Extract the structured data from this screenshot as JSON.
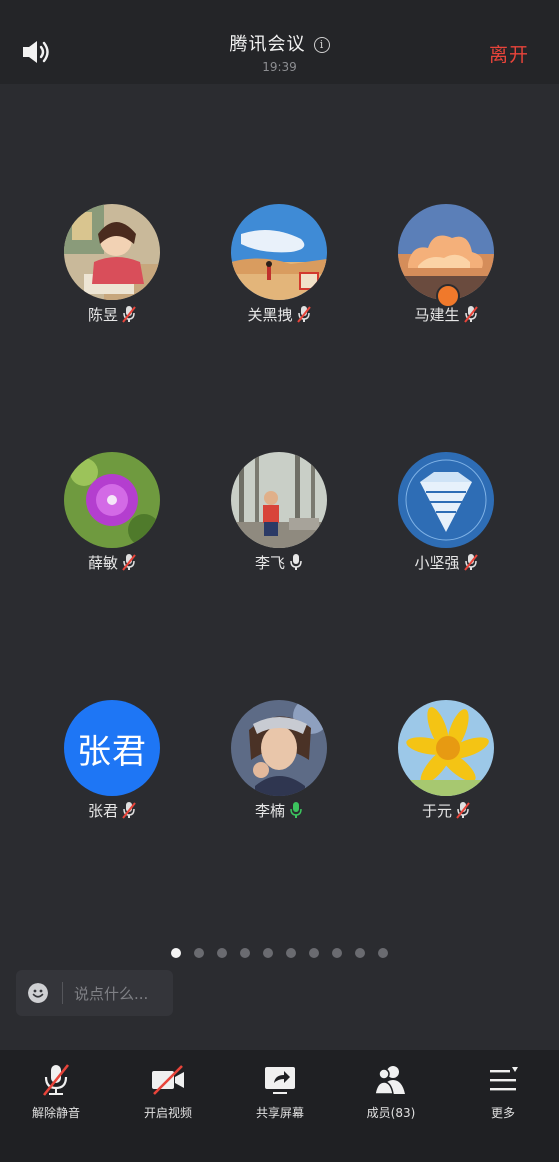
{
  "header": {
    "title": "腾讯会议",
    "time": "19:39",
    "leave_label": "离开",
    "speaker_icon": "speaker-icon",
    "info_icon": "info-icon"
  },
  "participants": [
    {
      "name": "陈昱",
      "mic": "muted",
      "avatar": "anime-girl-photo"
    },
    {
      "name": "关黑拽",
      "mic": "muted",
      "avatar": "desert-sky-photo"
    },
    {
      "name": "马建生",
      "mic": "muted",
      "avatar": "sunset-cloud-photo",
      "host": true
    },
    {
      "name": "薛敏",
      "mic": "muted",
      "avatar": "purple-flower-photo"
    },
    {
      "name": "李飞",
      "mic": "on",
      "avatar": "child-park-photo"
    },
    {
      "name": "小坚强",
      "mic": "muted",
      "avatar": "blue-diamond-graphic"
    },
    {
      "name": "张君",
      "mic": "muted",
      "avatar": "text-avatar",
      "avatar_text": "张君",
      "avatar_color": "#1e76f5"
    },
    {
      "name": "李楠",
      "mic": "speaking",
      "avatar": "painted-portrait"
    },
    {
      "name": "于元",
      "mic": "muted",
      "avatar": "sunflower-photo"
    }
  ],
  "page_indicator": {
    "count": 10,
    "current": 1
  },
  "chat": {
    "placeholder": "说点什么..."
  },
  "toolbar": [
    {
      "label": "解除静音",
      "icon": "mic-off-icon"
    },
    {
      "label": "开启视频",
      "icon": "video-off-icon"
    },
    {
      "label": "共享屏幕",
      "icon": "share-screen-icon"
    },
    {
      "label": "成员(83)",
      "icon": "members-icon"
    },
    {
      "label": "更多",
      "icon": "more-menu-icon"
    }
  ],
  "colors": {
    "background": "#2b2c30",
    "bar": "#242528",
    "leave": "#e8443a",
    "muted_slash": "#e8443a",
    "speaking": "#3cc45e",
    "host_badge": "#f0792b"
  }
}
